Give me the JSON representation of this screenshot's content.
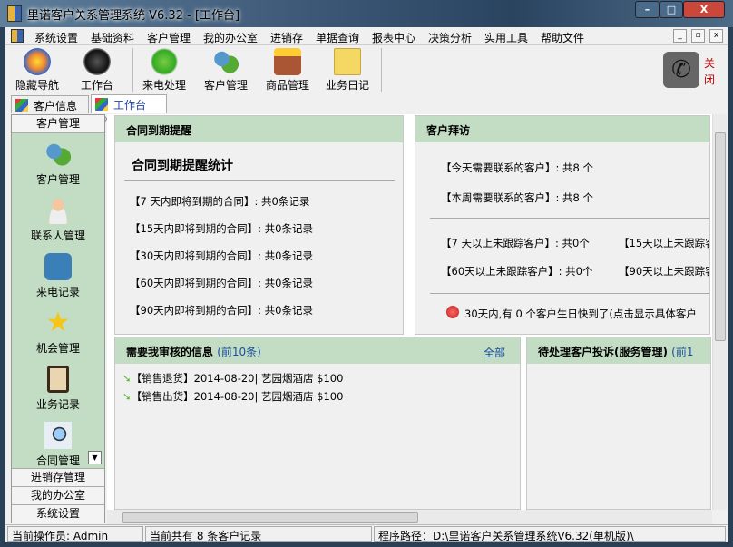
{
  "window": {
    "title": "里诺客户关系管理系统 V6.32 - [工作台]",
    "minimize": "–",
    "maximize": "□",
    "close": "X"
  },
  "menu": [
    "系统设置",
    "基础资料",
    "客户管理",
    "我的办公室",
    "进销存",
    "单据查询",
    "报表中心",
    "决策分析",
    "实用工具",
    "帮助文件"
  ],
  "mdi": {
    "min": "_",
    "restore": "▫",
    "close": "x"
  },
  "toolbar": {
    "items": [
      "隐藏导航",
      "工作台",
      "来电处理",
      "客户管理",
      "商品管理",
      "业务日记"
    ],
    "close_label": "关闭"
  },
  "tabs": [
    {
      "label": "客户信息"
    },
    {
      "label": "工作台",
      "close": "×"
    }
  ],
  "sidebar": {
    "header": "客户管理",
    "items": [
      "客户管理",
      "联系人管理",
      "来电记录",
      "机会管理",
      "业务记录",
      "合同管理"
    ],
    "sections": [
      "进销存管理",
      "我的办公室",
      "系统设置"
    ]
  },
  "contract": {
    "title": "合同到期提醒",
    "subtitle": "合同到期提醒统计",
    "rows": [
      "【7 天内即将到期的合同】: 共0条记录",
      "【15天内即将到期的合同】: 共0条记录",
      "【30天内即将到期的合同】: 共0条记录",
      "【60天内即将到期的合同】: 共0条记录",
      "【90天内即将到期的合同】: 共0条记录"
    ]
  },
  "visit": {
    "title": "客户拜访",
    "today": "【今天需要联系的客户】: 共8 个",
    "week": "【本周需要联系的客户】: 共8 个",
    "r7": "【7 天以上未跟踪客户】: 共0个",
    "r15": "【15天以上未跟踪客户",
    "r60": "【60天以上未跟踪客户】: 共0个",
    "r90": "【90天以上未跟踪客户",
    "birthday": "30天内,有 0 个客户生日快到了(点击显示具体客户"
  },
  "review": {
    "title": "需要我审核的信息",
    "count": "(前10条)",
    "all": "全部",
    "rows": [
      "【销售退货】2014-08-20| 艺园烟酒店 $100",
      "【销售出货】2014-08-20| 艺园烟酒店 $100"
    ]
  },
  "complaint": {
    "title": "待处理客户投诉(服务管理)",
    "count": "(前1"
  },
  "status": {
    "operator": "当前操作员: Admin",
    "records": "当前共有 8 条客户记录",
    "path": "程序路径：D:\\里诺客户关系管理系统V6.32(单机版)\\"
  },
  "colors": {
    "panel_header": "#c2ddc3",
    "link": "#1a4fa0"
  }
}
